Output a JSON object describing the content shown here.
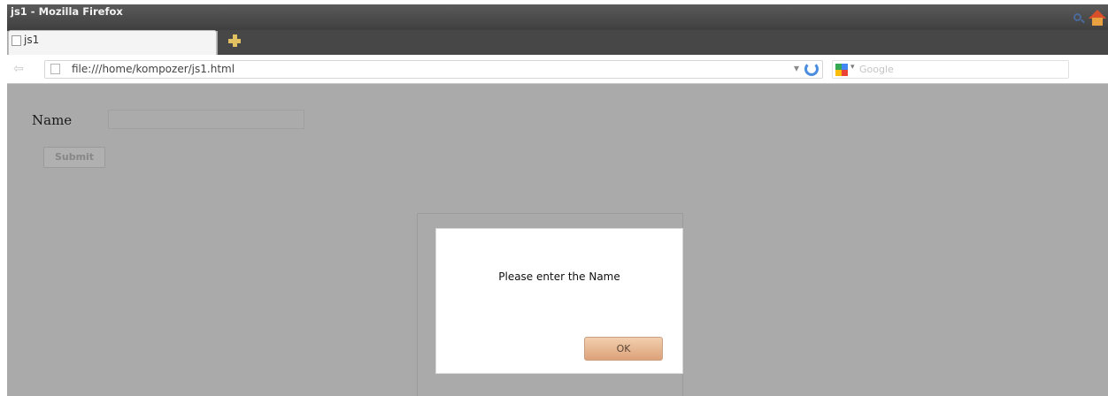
{
  "window": {
    "title": "js1 - Mozilla Firefox"
  },
  "tabs": [
    {
      "label": "js1"
    }
  ],
  "navbar": {
    "url": "file:///home/kompozer/js1.html",
    "search_placeholder": "Google"
  },
  "page": {
    "name_label": "Name",
    "name_value": "",
    "submit_label": "Submit"
  },
  "dialog": {
    "message": "Please enter the Name",
    "ok_label": "OK"
  },
  "icons": {
    "back": "back-arrow-icon",
    "page": "page-icon",
    "new_tab": "plus-icon",
    "star": "star-icon",
    "reload": "reload-icon",
    "search_engine": "google-icon",
    "search": "magnifier-icon",
    "home": "home-icon"
  },
  "colors": {
    "titlebar": "#4a4a4a",
    "overlay": "#aaaaaa",
    "ok_button": "#e2ad86"
  }
}
